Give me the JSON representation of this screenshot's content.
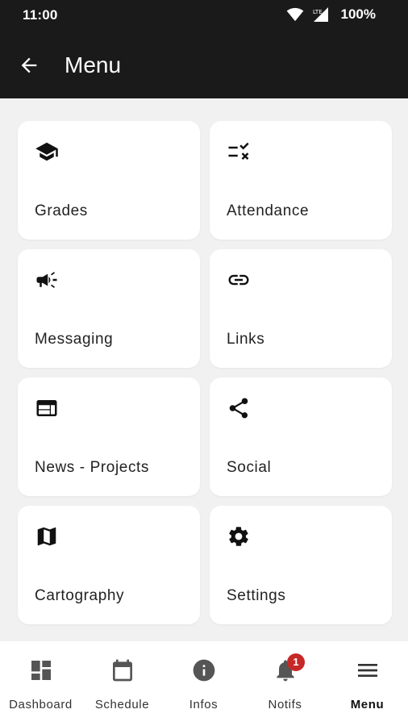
{
  "status_bar": {
    "time": "11:00",
    "battery": "100%",
    "network": "LTE"
  },
  "app_bar": {
    "title": "Menu"
  },
  "menu_items": [
    {
      "label": "Grades",
      "icon": "school-icon"
    },
    {
      "label": "Attendance",
      "icon": "checklist-icon"
    },
    {
      "label": "Messaging",
      "icon": "megaphone-icon"
    },
    {
      "label": "Links",
      "icon": "link-icon"
    },
    {
      "label": "News - Projects",
      "icon": "web-window-icon"
    },
    {
      "label": "Social",
      "icon": "share-icon"
    },
    {
      "label": "Cartography",
      "icon": "map-icon"
    },
    {
      "label": "Settings",
      "icon": "gear-icon"
    }
  ],
  "bottom_nav": [
    {
      "label": "Dashboard",
      "icon": "dashboard-icon",
      "active": false
    },
    {
      "label": "Schedule",
      "icon": "calendar-icon",
      "active": false
    },
    {
      "label": "Infos",
      "icon": "info-icon",
      "active": false
    },
    {
      "label": "Notifs",
      "icon": "bell-icon",
      "active": false,
      "badge": "1"
    },
    {
      "label": "Menu",
      "icon": "menu-icon",
      "active": true
    }
  ],
  "colors": {
    "app_bar": "#1a1a1a",
    "background": "#f1f1f1",
    "badge": "#c62828"
  }
}
